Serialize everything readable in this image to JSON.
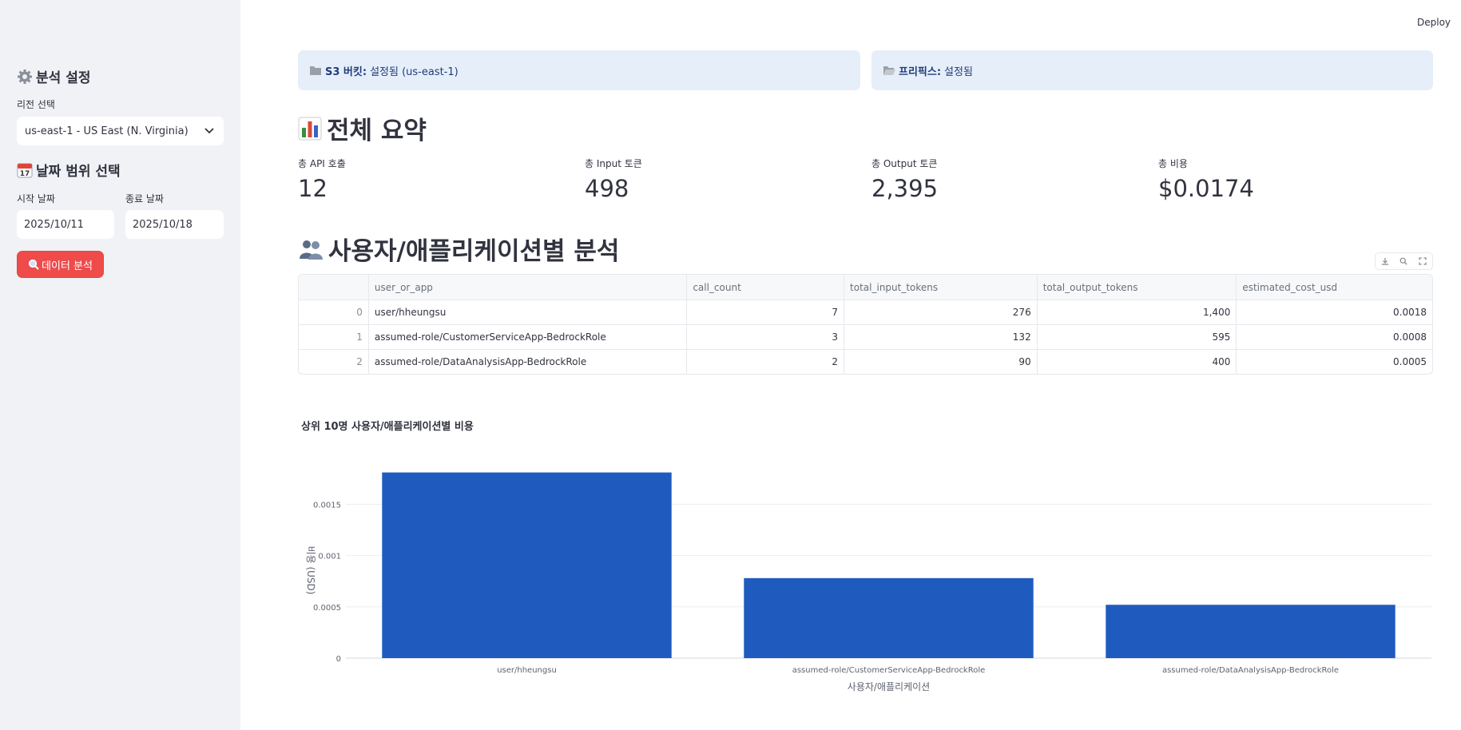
{
  "sidebar": {
    "settings_title": "분석 설정",
    "settings_icon": "gear-icon",
    "region_label": "리전 선택",
    "region_value": "us-east-1 - US East (N. Virginia)",
    "date_title": "날짜 범위 선택",
    "date_icon": "calendar-icon",
    "start_label": "시작 날짜",
    "start_value": "2025/10/11",
    "end_label": "종료 날짜",
    "end_value": "2025/10/18",
    "analyze_button": "데이터 분석",
    "analyze_icon": "magnifier-icon"
  },
  "header": {
    "deploy": "Deploy"
  },
  "info": {
    "bucket_label": "S3 버킷:",
    "bucket_value": "설정됨 (us-east-1)",
    "prefix_label": "프리픽스:",
    "prefix_value": "설정됨"
  },
  "summary": {
    "title": "전체 요약",
    "metrics": [
      {
        "label": "총 API 호출",
        "value": "12"
      },
      {
        "label": "총 Input 토큰",
        "value": "498"
      },
      {
        "label": "총 Output 토큰",
        "value": "2,395"
      },
      {
        "label": "총 비용",
        "value": "$0.0174"
      }
    ]
  },
  "users": {
    "title": "사용자/애플리케이션별 분석",
    "columns": [
      "",
      "user_or_app",
      "call_count",
      "total_input_tokens",
      "total_output_tokens",
      "estimated_cost_usd"
    ],
    "rows": [
      [
        "0",
        "user/hheungsu",
        "7",
        "276",
        "1,400",
        "0.0018"
      ],
      [
        "1",
        "assumed-role/CustomerServiceApp-BedrockRole",
        "3",
        "132",
        "595",
        "0.0008"
      ],
      [
        "2",
        "assumed-role/DataAnalysisApp-BedrockRole",
        "2",
        "90",
        "400",
        "0.0005"
      ]
    ]
  },
  "chart_data": {
    "type": "bar",
    "title": "상위 10명 사용자/애플리케이션별 비용",
    "categories": [
      "user/hheungsu",
      "assumed-role/CustomerServiceApp-BedrockRole",
      "assumed-role/DataAnalysisApp-BedrockRole"
    ],
    "values": [
      0.00181,
      0.00078,
      0.00052
    ],
    "xlabel": "사용자/애플리케이션",
    "ylabel": "비용 (USD)",
    "ylim": [
      0,
      0.0019
    ],
    "yticks": [
      0,
      0.0005,
      0.001,
      0.0015
    ],
    "ytick_labels": [
      "0",
      "0.0005",
      "0.001",
      "0.0015"
    ],
    "grid": true,
    "bar_color": "#1f5bbf"
  }
}
